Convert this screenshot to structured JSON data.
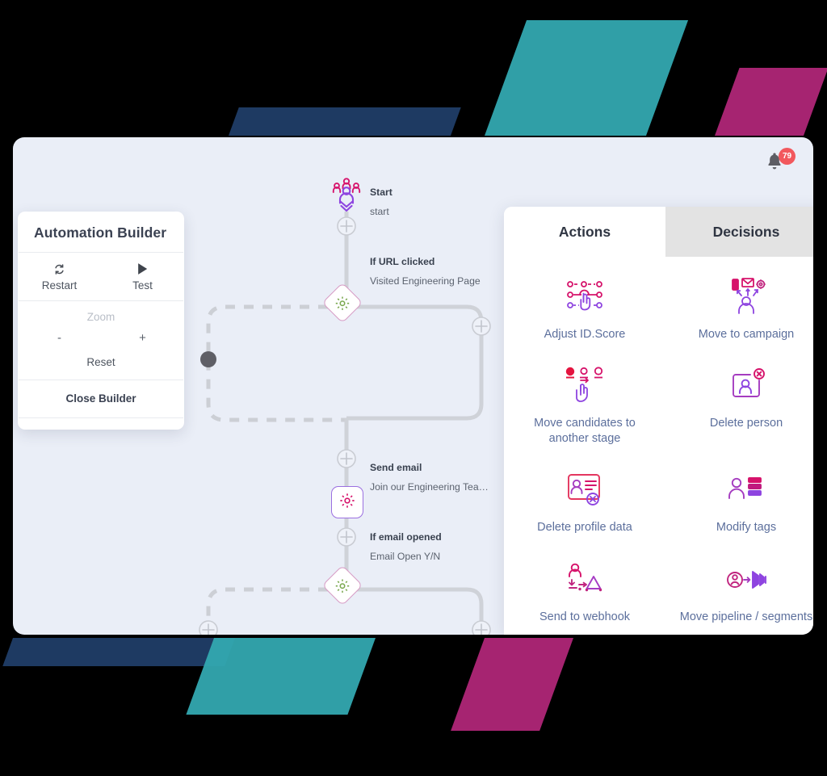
{
  "builder": {
    "title": "Automation Builder",
    "restart_label": "Restart",
    "restart_icon": "restart-icon",
    "test_label": "Test",
    "test_icon": "play-icon",
    "zoom_label": "Zoom",
    "zoom_out_label": "-",
    "zoom_in_label": "+",
    "reset_label": "Reset",
    "close_label": "Close Builder"
  },
  "header": {
    "bell_icon": "bell-icon",
    "notification_count": "79"
  },
  "flow": {
    "nodes": [
      {
        "title": "Start",
        "subtitle": "start",
        "icon": "audience-start-icon",
        "type": "start"
      },
      {
        "title": "If URL clicked",
        "subtitle": "Visited Engineering Page",
        "icon": "gear-icon",
        "type": "decision"
      },
      {
        "title": "Send email",
        "subtitle": "Join our Engineering Tea…",
        "icon": "gear-icon",
        "type": "action"
      },
      {
        "title": "If email opened",
        "subtitle": "Email Open Y/N",
        "icon": "gear-icon",
        "type": "decision"
      }
    ],
    "connector_icon": "plus-circle-icon",
    "drag_handle_icon": "drag-handle-icon"
  },
  "panel": {
    "tabs": [
      {
        "label": "Actions",
        "active": true
      },
      {
        "label": "Decisions",
        "active": false
      }
    ],
    "items": [
      {
        "label": "Adjust ID.Score",
        "icon": "adjust-score-icon"
      },
      {
        "label": "Move to campaign",
        "icon": "move-to-campaign-icon"
      },
      {
        "label": "Move candidates to another stage",
        "icon": "move-candidates-icon"
      },
      {
        "label": "Delete person",
        "icon": "delete-person-icon"
      },
      {
        "label": "Delete profile data",
        "icon": "delete-profile-data-icon"
      },
      {
        "label": "Modify tags",
        "icon": "modify-tags-icon"
      },
      {
        "label": "Send to webhook",
        "icon": "send-to-webhook-icon"
      },
      {
        "label": "Move pipeline / segments",
        "icon": "move-pipeline-icon"
      }
    ]
  },
  "colors": {
    "canvas_bg": "#eaeef7",
    "accent_magenta": "#d6136b",
    "accent_purple": "#8e44e0",
    "badge_red": "#f2585d",
    "teal": "#33a8b0",
    "navy": "#1e3a62",
    "magenta_shape": "#a62471",
    "label_blue": "#5c6f9c"
  }
}
